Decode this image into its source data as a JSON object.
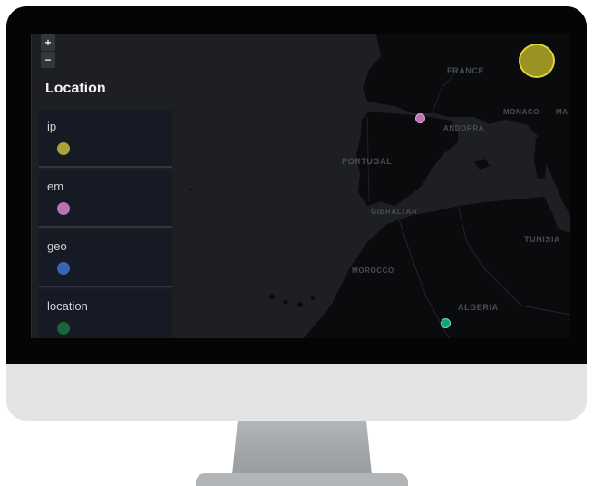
{
  "map": {
    "zoom_in_label": "+",
    "zoom_out_label": "−",
    "labels": {
      "france": "FRANCE",
      "andorra": "ANDORRA",
      "monaco": "MONACO",
      "monaco_partial": "MA",
      "portugal": "PORTUGAL",
      "gibraltar": "GIBRALTAR",
      "tunisia": "TUNISIA",
      "morocco": "MOROCCO",
      "algeria": "ALGERIA"
    },
    "colors": {
      "background": "#1d1f22",
      "land": "#090a0c",
      "ip": "#a8a33a",
      "em": "#b874b0",
      "geo": "#3a64b6",
      "location": "#1aa079"
    }
  },
  "legend": {
    "title": "Location",
    "items": [
      {
        "label": "ip",
        "color": "#a8a33a"
      },
      {
        "label": "em",
        "color": "#b874b0"
      },
      {
        "label": "geo",
        "color": "#3a64b6"
      },
      {
        "label": "location",
        "color": "#19653f"
      }
    ]
  }
}
